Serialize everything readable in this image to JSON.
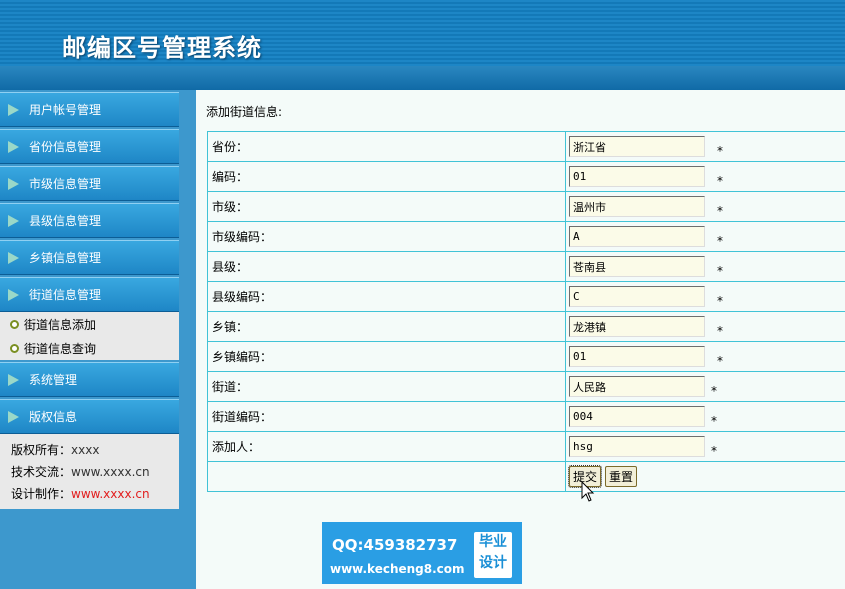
{
  "header": {
    "title": "邮编区号管理系统"
  },
  "sidebar": {
    "items": [
      {
        "label": "用户帐号管理"
      },
      {
        "label": "省份信息管理"
      },
      {
        "label": "市级信息管理"
      },
      {
        "label": "县级信息管理"
      },
      {
        "label": "乡镇信息管理"
      },
      {
        "label": "街道信息管理"
      },
      {
        "label": "系统管理"
      },
      {
        "label": "版权信息"
      }
    ],
    "submenu": [
      {
        "label": "街道信息添加"
      },
      {
        "label": "街道信息查询"
      }
    ],
    "info": {
      "copyright_label": "版权所有：",
      "copyright_value": "xxxx",
      "tech_label": "技术交流：",
      "tech_value": "www.xxxx.cn",
      "design_label": "设计制作：",
      "design_value": "www.xxxx.cn"
    }
  },
  "main": {
    "title": "添加街道信息:",
    "rows": [
      {
        "label": "省份：",
        "value": "浙江省"
      },
      {
        "label": "编码：",
        "value": "01"
      },
      {
        "label": "市级：",
        "value": "温州市"
      },
      {
        "label": "市级编码：",
        "value": "A"
      },
      {
        "label": "县级：",
        "value": "苍南县"
      },
      {
        "label": "县级编码：",
        "value": "C"
      },
      {
        "label": "乡镇：",
        "value": "龙港镇"
      },
      {
        "label": "乡镇编码：",
        "value": "01"
      },
      {
        "label": "街道：",
        "value": "人民路"
      },
      {
        "label": "街道编码：",
        "value": "004"
      },
      {
        "label": "添加人：",
        "value": "hsg"
      }
    ],
    "required_mark": "*",
    "submit_label": "提交",
    "reset_label": "重置"
  },
  "watermark": {
    "qq": "QQ:459382737",
    "url": "www.kecheng8.com",
    "badge_line1": "毕业",
    "badge_line2": "设计"
  },
  "colors": {
    "header_blue": "#1d86c6",
    "menu_blue": "#2a95d2",
    "table_border": "#41c3d6",
    "required_red": "#e21d1d"
  }
}
